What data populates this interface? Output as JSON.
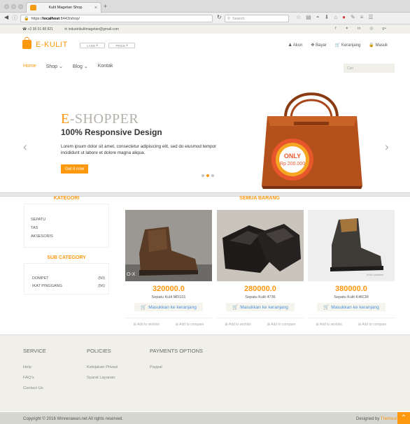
{
  "browser": {
    "tab_title": "Kulit Magetan Shop",
    "new_tab": "+",
    "url_prefix": "https://",
    "url_host": "localhost",
    "url_rest": ":8443/shop/",
    "search_placeholder": "Search"
  },
  "contact": {
    "phone": "+2 95 01 88 821",
    "email": "industrikulitmagetan@gmail.com"
  },
  "social_icons": [
    "facebook-icon",
    "twitter-icon",
    "linkedin-icon",
    "dribbble-icon",
    "google-plus-icon"
  ],
  "brand": {
    "logo_text": "E-KULIT",
    "lang_label": "LANG",
    "price_label": "PRICE",
    "accent": "#fe980f"
  },
  "account": {
    "akun": "Akun",
    "bayar": "Bayar",
    "keranjang": "Keranjang",
    "masuk": "Masuk"
  },
  "nav": {
    "home": "Home",
    "shop": "Shop",
    "blog": "Blog",
    "kontak": "Kontak",
    "search_placeholder": "Cari"
  },
  "slider": {
    "title_first": "E",
    "title_rest": "-SHOPPER",
    "subtitle": "100% Responsive Design",
    "description": "Lorem ipsum dolor sit amet, consectetur adipisicing elit, sed do eiusmod tempor incididunt ut labore et dolore magna aliqua.",
    "cta": "Get it now",
    "badge_top": "ONLY",
    "badge_price": "Rp 200.000",
    "active_dot": 1
  },
  "sidebar": {
    "kategori_title": "KATEGORI",
    "kategori": [
      "SEPATU",
      "TAS",
      "AKSESORIS"
    ],
    "sub_title": "SUB CATEGORY",
    "sub": [
      {
        "name": "DOMPET",
        "count": "(50)"
      },
      {
        "name": "IKAT PINGGANG",
        "count": "(56)"
      }
    ]
  },
  "products_title": "SEMUA BARANG",
  "products": [
    {
      "price": "320000.0",
      "name": "Sepatu Kulit MD101",
      "cart": "Masukkan ke keranjang",
      "wishlist": "Add to wishlist",
      "compare": "Add to compare"
    },
    {
      "price": "280000.0",
      "name": "Sepatu Kulit 4736",
      "cart": "Masukkan ke keranjang",
      "wishlist": "Add to wishlist",
      "compare": "Add to compare"
    },
    {
      "price": "380000.0",
      "name": "Sepatu Kulit K46CM",
      "cart": "Masukkan ke keranjang",
      "wishlist": "Add to wishlist",
      "compare": "Add to compare"
    }
  ],
  "footer": {
    "service_title": "SERVICE",
    "service": [
      "Help",
      "FAQ's",
      "Contact Us"
    ],
    "policies_title": "POLICIES",
    "policies": [
      "Kebijakan Privasi",
      "Syarat Layanan"
    ],
    "payments_title": "PAYMENTS OPTIONS",
    "payments": [
      "Paypal"
    ],
    "copyright": "Copyright © 2016 Winnerawan.net All rights reserved.",
    "designed_by": "Designed by",
    "designer": "Themeum"
  }
}
